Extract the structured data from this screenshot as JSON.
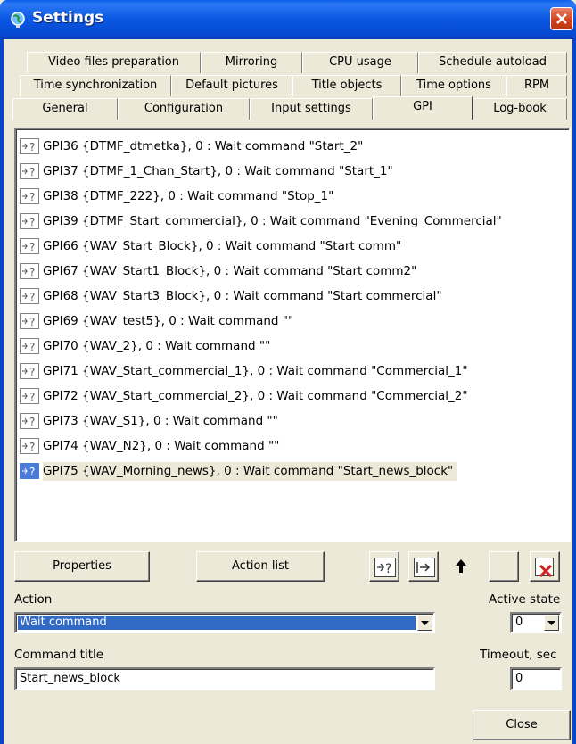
{
  "window": {
    "title": "Settings",
    "icons": {
      "app": "globe-icon",
      "close": "close-icon"
    }
  },
  "tabs": {
    "row1": [
      "Video files preparation",
      "Mirroring",
      "CPU usage",
      "Schedule autoload"
    ],
    "row2": [
      "Time synchronization",
      "Default pictures",
      "Title objects",
      "Time options",
      "RPM"
    ],
    "row3": [
      "General",
      "Configuration",
      "Input settings",
      "GPI",
      "Log-book"
    ],
    "active": "GPI"
  },
  "gpi_list": {
    "items": [
      "GPI36 {DTMF_dtmetka}, 0 : Wait command \"Start_2\"",
      "GPI37 {DTMF_1_Chan_Start}, 0 : Wait command \"Start_1\"",
      "GPI38 {DTMF_222}, 0 : Wait command \"Stop_1\"",
      "GPI39 {DTMF_Start_commercial}, 0 : Wait command \"Evening_Commercial\"",
      "GPI66 {WAV_Start_Block}, 0 : Wait command \"Start comm\"",
      "GPI67 {WAV_Start1_Block}, 0 : Wait command \"Start comm2\"",
      "GPI68 {WAV_Start3_Block}, 0 : Wait command \"Start commercial\"",
      "GPI69 {WAV_test5}, 0 : Wait command \"\"",
      "GPI70 {WAV_2}, 0 : Wait command \"\"",
      "GPI71 {WAV_Start_commercial_1}, 0 : Wait command \"Commercial_1\"",
      "GPI72 {WAV_Start_commercial_2}, 0 : Wait command \"Commercial_2\"",
      "GPI73 {WAV_S1}, 0 : Wait command \"\"",
      "GPI74 {WAV_N2}, 0 : Wait command \"\"",
      "GPI75 {WAV_Morning_news}, 0 : Wait command \"Start_news_block\""
    ],
    "selected_index": 13
  },
  "toolbar": {
    "properties_label": "Properties",
    "action_list_label": "Action list",
    "icons": [
      "gpi-add-icon",
      "gpi-action-icon",
      "arrow-up-icon",
      "blank-icon",
      "delete-icon"
    ]
  },
  "form": {
    "action_label": "Action",
    "action_value": "Wait command",
    "active_state_label": "Active state",
    "active_state_value": "0",
    "command_title_label": "Command title",
    "command_title_value": "Start_news_block",
    "timeout_label": "Timeout, sec",
    "timeout_value": "0"
  },
  "footer": {
    "close_label": "Close"
  }
}
